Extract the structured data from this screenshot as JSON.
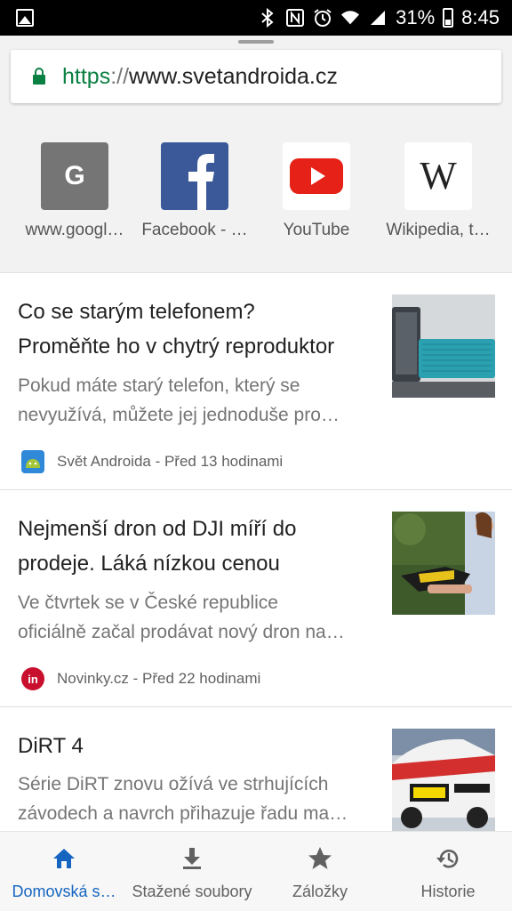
{
  "status_bar": {
    "battery": "31%",
    "time": "8:45"
  },
  "url_bar": {
    "scheme": "https",
    "separator": "://",
    "host": "www.svetandroida.cz"
  },
  "tiles": [
    {
      "label": "www.googl…",
      "icon": "google-g-icon",
      "letter": "G"
    },
    {
      "label": "Facebook - …",
      "icon": "facebook-icon"
    },
    {
      "label": "YouTube",
      "icon": "youtube-icon"
    },
    {
      "label": "Wikipedia, t…",
      "icon": "wikipedia-icon",
      "letter": "W"
    }
  ],
  "articles": [
    {
      "title_line1": "Co se starým telefonem?",
      "title_line2": "Proměňte ho v chytrý reproduktor",
      "snippet_line1": "Pokud máte starý telefon, který se",
      "snippet_line2": "nevyužívá, můžete jej jednoduše pro…",
      "source": "Svět Androida - Před 13 hodinami"
    },
    {
      "title_line1": "Nejmenší dron od DJI míří do",
      "title_line2": "prodeje. Láká nízkou cenou",
      "snippet_line1": "Ve čtvrtek se v České republice",
      "snippet_line2": "oficiálně začal prodávat nový dron na…",
      "source": "Novinky.cz - Před 22 hodinami",
      "source_badge": "in"
    },
    {
      "title_line1": "DiRT 4",
      "snippet_line1": "Série DiRT znovu ožívá ve strhujících",
      "snippet_line2": "závodech a navrch přihazuje řadu ma…"
    }
  ],
  "bottom_nav": [
    {
      "label": "Domovská s…",
      "icon": "home-icon",
      "active": true
    },
    {
      "label": "Stažené soubory",
      "icon": "download-icon"
    },
    {
      "label": "Záložky",
      "icon": "star-icon"
    },
    {
      "label": "Historie",
      "icon": "history-icon"
    }
  ],
  "colors": {
    "accent": "#1565c0",
    "secure_green": "#0b8043",
    "facebook": "#3b5998",
    "youtube": "#e62117"
  }
}
